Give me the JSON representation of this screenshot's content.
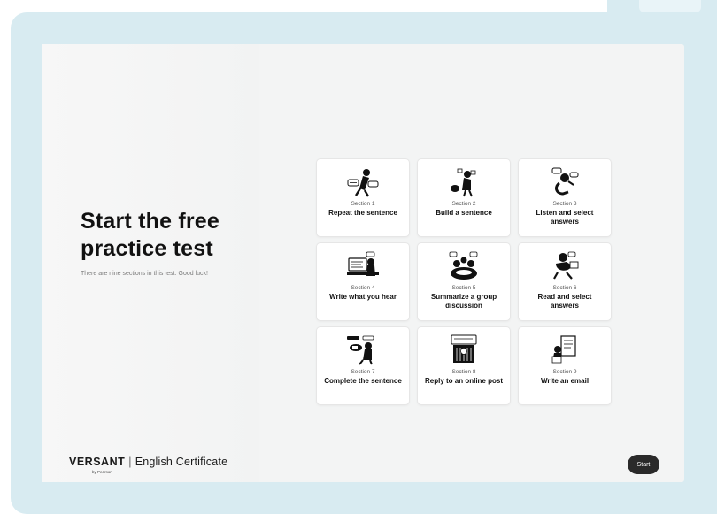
{
  "intro": {
    "title": "Start the free practice test",
    "subtitle": "There are nine sections in this test. Good luck!"
  },
  "sections": [
    {
      "section": "Section 1",
      "label": "Repeat the sentence",
      "icon": "speech-bubble-person-icon"
    },
    {
      "section": "Section 2",
      "label": "Build a sentence",
      "icon": "building-blocks-person-icon"
    },
    {
      "section": "Section 3",
      "label": "Listen and select answers",
      "icon": "listening-person-icon"
    },
    {
      "section": "Section 4",
      "label": "Write what you hear",
      "icon": "laptop-person-icon"
    },
    {
      "section": "Section 5",
      "label": "Summarize a group discussion",
      "icon": "group-discussion-icon"
    },
    {
      "section": "Section 6",
      "label": "Read and select answers",
      "icon": "reading-person-icon"
    },
    {
      "section": "Section 7",
      "label": "Complete the sentence",
      "icon": "sentence-pieces-icon"
    },
    {
      "section": "Section 8",
      "label": "Reply to an online post",
      "icon": "online-post-icon"
    },
    {
      "section": "Section 9",
      "label": "Write an email",
      "icon": "email-person-icon"
    }
  ],
  "brand": {
    "name": "VERSANT",
    "product": "English Certificate",
    "byline": "by Pearson"
  },
  "actions": {
    "start_label": "Start"
  },
  "colors": {
    "frame": "#d8ebf1",
    "screen": "#f3f4f4",
    "button": "#2a2a2a"
  }
}
